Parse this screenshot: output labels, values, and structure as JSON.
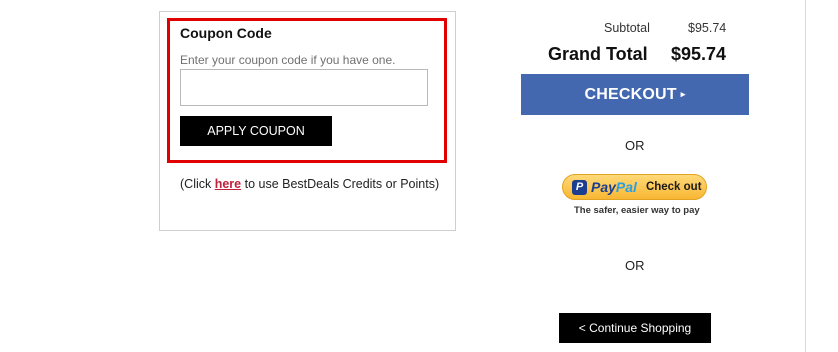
{
  "coupon": {
    "title": "Coupon Code",
    "hint": "Enter your coupon code if you have one.",
    "input_value": "",
    "input_placeholder": "",
    "apply_label": "APPLY COUPON",
    "credits_prefix": "(Click ",
    "credits_link": "here",
    "credits_suffix": " to use BestDeals Credits or Points)"
  },
  "totals": {
    "subtotal_label": "Subtotal",
    "subtotal_value": "$95.74",
    "grand_label": "Grand Total",
    "grand_value": "$95.74"
  },
  "checkout": {
    "label": "CHECKOUT",
    "arrow": "▸"
  },
  "or_text": "OR",
  "paypal": {
    "mark": "P",
    "word_pay": "Pay",
    "word_pal": "Pal",
    "checkout_label": "Check out",
    "tagline": "The safer, easier way to pay"
  },
  "continue": {
    "label": "< Continue Shopping"
  },
  "colors": {
    "highlight": "#e00000",
    "checkout_bg": "#4468b0",
    "link": "#c0213b",
    "paypal_gold": "#f8b733",
    "paypal_navy": "#1b3f8e"
  }
}
